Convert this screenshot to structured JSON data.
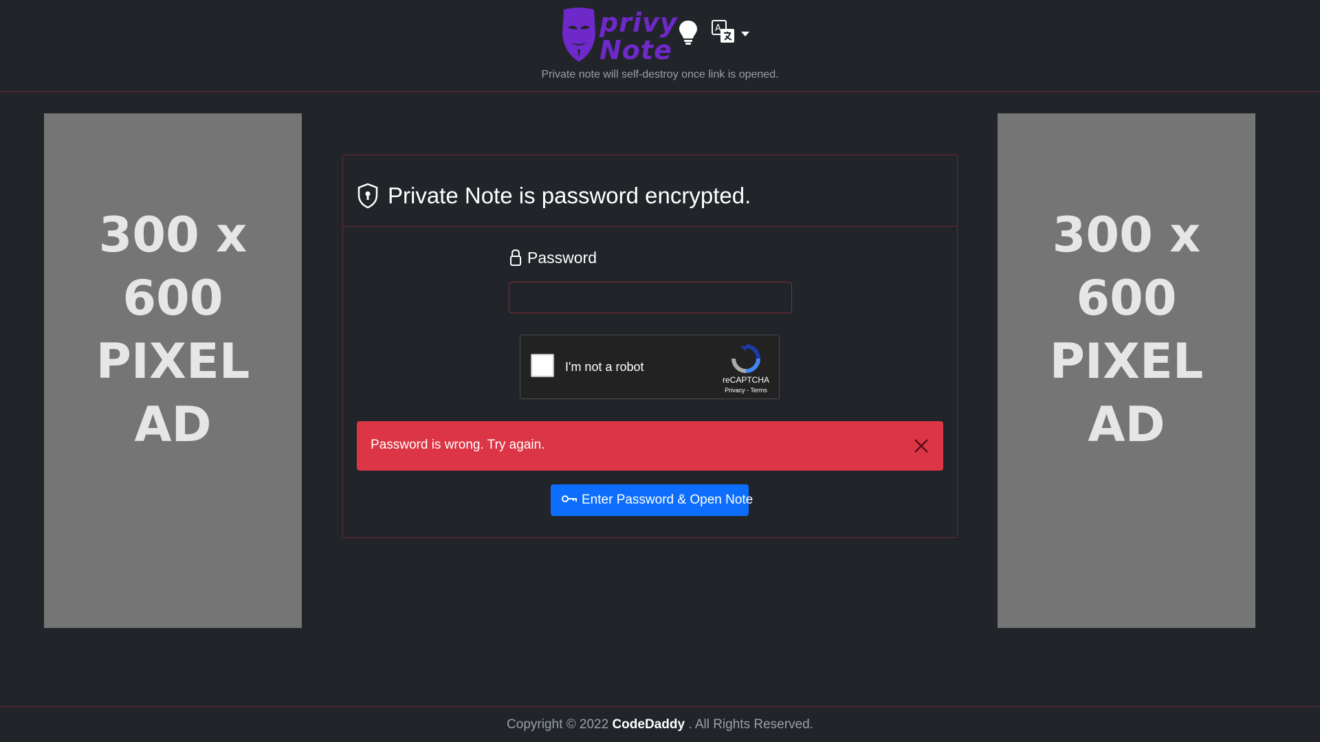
{
  "header": {
    "logo_word1": "privy",
    "logo_word2": "Note",
    "tagline": "Private note will self-destroy once link is opened.",
    "theme_icon": "lightbulb-icon",
    "language_icon": "translate-icon",
    "brand_color": "#6f28c9"
  },
  "ads": {
    "left": {
      "line1": "300 x 600",
      "line2": "PIXEL",
      "line3": "AD"
    },
    "right": {
      "line1": "300 x 600",
      "line2": "PIXEL",
      "line3": "AD"
    }
  },
  "card": {
    "title": "Private Note is password encrypted.",
    "password_label": "Password",
    "password_value": "",
    "recaptcha": {
      "label": "I'm not a robot",
      "brand": "reCAPTCHA",
      "links": "Privacy - Terms"
    },
    "alert": {
      "message": "Password is wrong. Try again.",
      "color": "#dc3545"
    },
    "submit_label": "Enter Password & Open Note",
    "accent_color": "#0d6efd"
  },
  "footer": {
    "prefix": "Copyright © 2022",
    "brand": "CodeDaddy",
    "suffix": ". All Rights Reserved."
  }
}
